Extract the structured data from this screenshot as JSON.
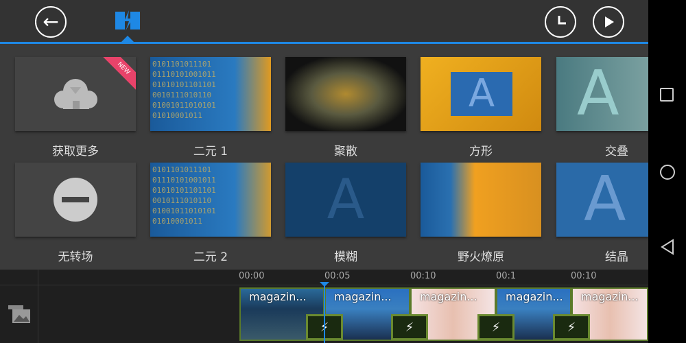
{
  "toolbar": {
    "back": "back-icon",
    "transition_tab": "transition-icon",
    "timer": "clock-icon",
    "play": "play-icon"
  },
  "tiles": [
    {
      "label": "获取更多",
      "badge": "NEW"
    },
    {
      "label": "二元 1"
    },
    {
      "label": "聚散"
    },
    {
      "label": "方形"
    },
    {
      "label": "交叠"
    },
    {
      "label": "无转场"
    },
    {
      "label": "二元 2"
    },
    {
      "label": "模糊"
    },
    {
      "label": "野火燎原"
    },
    {
      "label": "结晶"
    }
  ],
  "timeline": {
    "ticks": [
      "00:00",
      "00:05",
      "00:10",
      "00:1",
      "00:10"
    ],
    "clips": [
      "magazin...",
      "magazin...",
      "magazin...",
      "magazin...",
      "magazin..."
    ]
  },
  "colors": {
    "accent": "#1e88e5",
    "clip_border": "#5a7a2a",
    "badge": "#e8436a"
  }
}
